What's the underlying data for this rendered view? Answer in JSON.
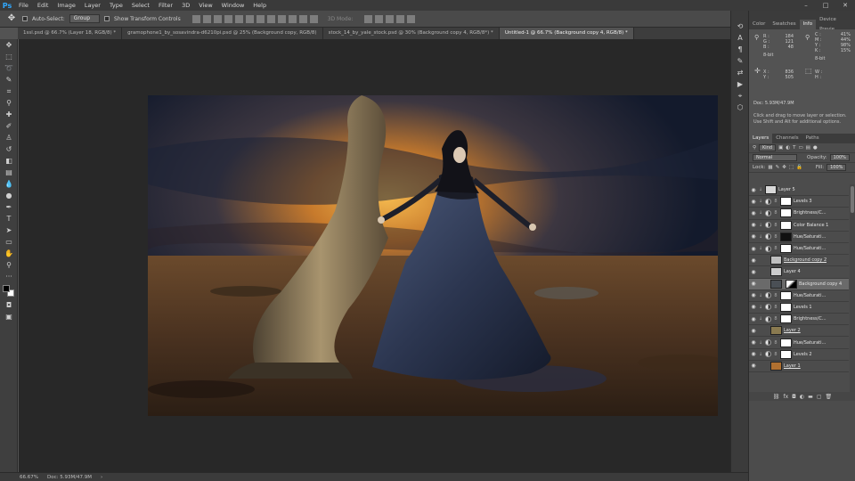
{
  "menubar": {
    "logo": "Ps",
    "items": [
      "File",
      "Edit",
      "Image",
      "Layer",
      "Type",
      "Select",
      "Filter",
      "3D",
      "View",
      "Window",
      "Help"
    ]
  },
  "options": {
    "auto_select_label": "Auto-Select:",
    "auto_select_value": "Group",
    "show_transform_label": "Show Transform Controls",
    "mode_3d_label": "3D Mode:"
  },
  "tabs": [
    {
      "label": "1ssl.psd @ 66.7% (Layer 18, RGB/8) *",
      "active": false
    },
    {
      "label": "gramophone1_by_sosavindra-d6210pi.psd @ 25% (Background copy, RGB/8)",
      "active": false
    },
    {
      "label": "stock_14_by_yale_stock.psd @ 30% (Background copy 4, RGB/8*) *",
      "active": false
    },
    {
      "label": "Untitled-1 @ 66.7% (Background copy 4, RGB/8) *",
      "active": true
    }
  ],
  "status": {
    "zoom": "66.67%",
    "doc": "Doc: 5.93M/47.9M"
  },
  "panel_tabs_top": [
    {
      "label": "Color",
      "active": false
    },
    {
      "label": "Swatches",
      "active": false
    },
    {
      "label": "Info",
      "active": true
    },
    {
      "label": "Device Previe",
      "active": false
    }
  ],
  "info": {
    "rgb_labels": [
      "R :",
      "G :",
      "B :"
    ],
    "rgb_values": [
      "184",
      "121",
      "48"
    ],
    "cmyk_labels": [
      "C :",
      "M :",
      "Y :",
      "K :"
    ],
    "cmyk_values": [
      "41%",
      "44%",
      "98%",
      "15%"
    ],
    "bit_left": "8-bit",
    "bit_right": "8-bit",
    "xy_labels": [
      "X :",
      "Y :"
    ],
    "xy_values": [
      "836",
      "505"
    ],
    "wh_labels": [
      "W :",
      "H :"
    ],
    "doc": "Doc: 5.93M/47.9M",
    "hint": "Click and drag to move layer or selection.  Use Shift and Alt for additional options."
  },
  "layers_panel": {
    "tabs": [
      {
        "label": "Layers",
        "active": true
      },
      {
        "label": "Channels",
        "active": false
      },
      {
        "label": "Paths",
        "active": false
      }
    ],
    "kind_label": "Kind",
    "blend_mode": "Normal",
    "opacity_label": "Opacity:",
    "opacity_value": "100%",
    "lock_label": "Lock:",
    "fill_label": "Fill:",
    "fill_value": "100%",
    "layers": [
      {
        "name": "Layer 5",
        "type": "pixel",
        "clipped": true,
        "thumb": "#d8d8d8",
        "link": false,
        "selected": false
      },
      {
        "name": "Levels 3",
        "type": "adjust",
        "clipped": true,
        "mask": "#ffffff",
        "link": false,
        "selected": false
      },
      {
        "name": "Brightness/C...",
        "type": "adjust",
        "clipped": true,
        "mask": "#ffffff",
        "link": false,
        "selected": false
      },
      {
        "name": "Color Balance 1",
        "type": "adjust",
        "clipped": true,
        "mask": "#ffffff",
        "link": false,
        "selected": false
      },
      {
        "name": "Hue/Saturati...",
        "type": "adjust",
        "clipped": true,
        "mask": "#111111",
        "link": false,
        "selected": false
      },
      {
        "name": "Hue/Saturati...",
        "type": "adjust",
        "clipped": true,
        "mask": "#ffffff",
        "link": false,
        "selected": false
      },
      {
        "name": "Background copy 2",
        "type": "pixel",
        "clipped": false,
        "thumb": "#bfbfbf",
        "link": true,
        "selected": false
      },
      {
        "name": "Layer 4",
        "type": "pixel",
        "clipped": false,
        "thumb": "#cccccc",
        "link": false,
        "selected": false
      },
      {
        "name": "Background copy 4",
        "type": "pixel",
        "clipped": false,
        "thumb": "#4a4f55",
        "link": false,
        "selected": true
      },
      {
        "name": "Hue/Saturati...",
        "type": "adjust",
        "clipped": true,
        "mask": "#ffffff",
        "link": false,
        "selected": false
      },
      {
        "name": "Levels 1",
        "type": "adjust",
        "clipped": true,
        "mask": "#ffffff",
        "link": false,
        "selected": false
      },
      {
        "name": "Brightness/C...",
        "type": "adjust",
        "clipped": true,
        "mask": "#ffffff",
        "link": false,
        "selected": false
      },
      {
        "name": "Layer 2",
        "type": "pixel",
        "clipped": false,
        "thumb": "#8a7a50",
        "link": true,
        "selected": false
      },
      {
        "name": "Hue/Saturati...",
        "type": "adjust",
        "clipped": true,
        "mask": "#ffffff",
        "link": false,
        "selected": false
      },
      {
        "name": "Levels 2",
        "type": "adjust",
        "clipped": true,
        "mask": "#ffffff",
        "link": false,
        "selected": false
      },
      {
        "name": "Layer 1",
        "type": "pixel",
        "clipped": false,
        "thumb": "#b07030",
        "link": true,
        "selected": false
      }
    ],
    "footer_icons": [
      "link-layers-icon",
      "fx-icon",
      "add-mask-icon",
      "adjustment-icon",
      "group-icon",
      "new-layer-icon",
      "trash-icon"
    ]
  },
  "colors": {
    "ui_dark": "#3a3a3a",
    "ui_mid": "#535353",
    "canvas_bg": "#282828",
    "accent": "#31a8ff",
    "sky_glow": "#e8a040",
    "dress": "#2f3a55"
  }
}
